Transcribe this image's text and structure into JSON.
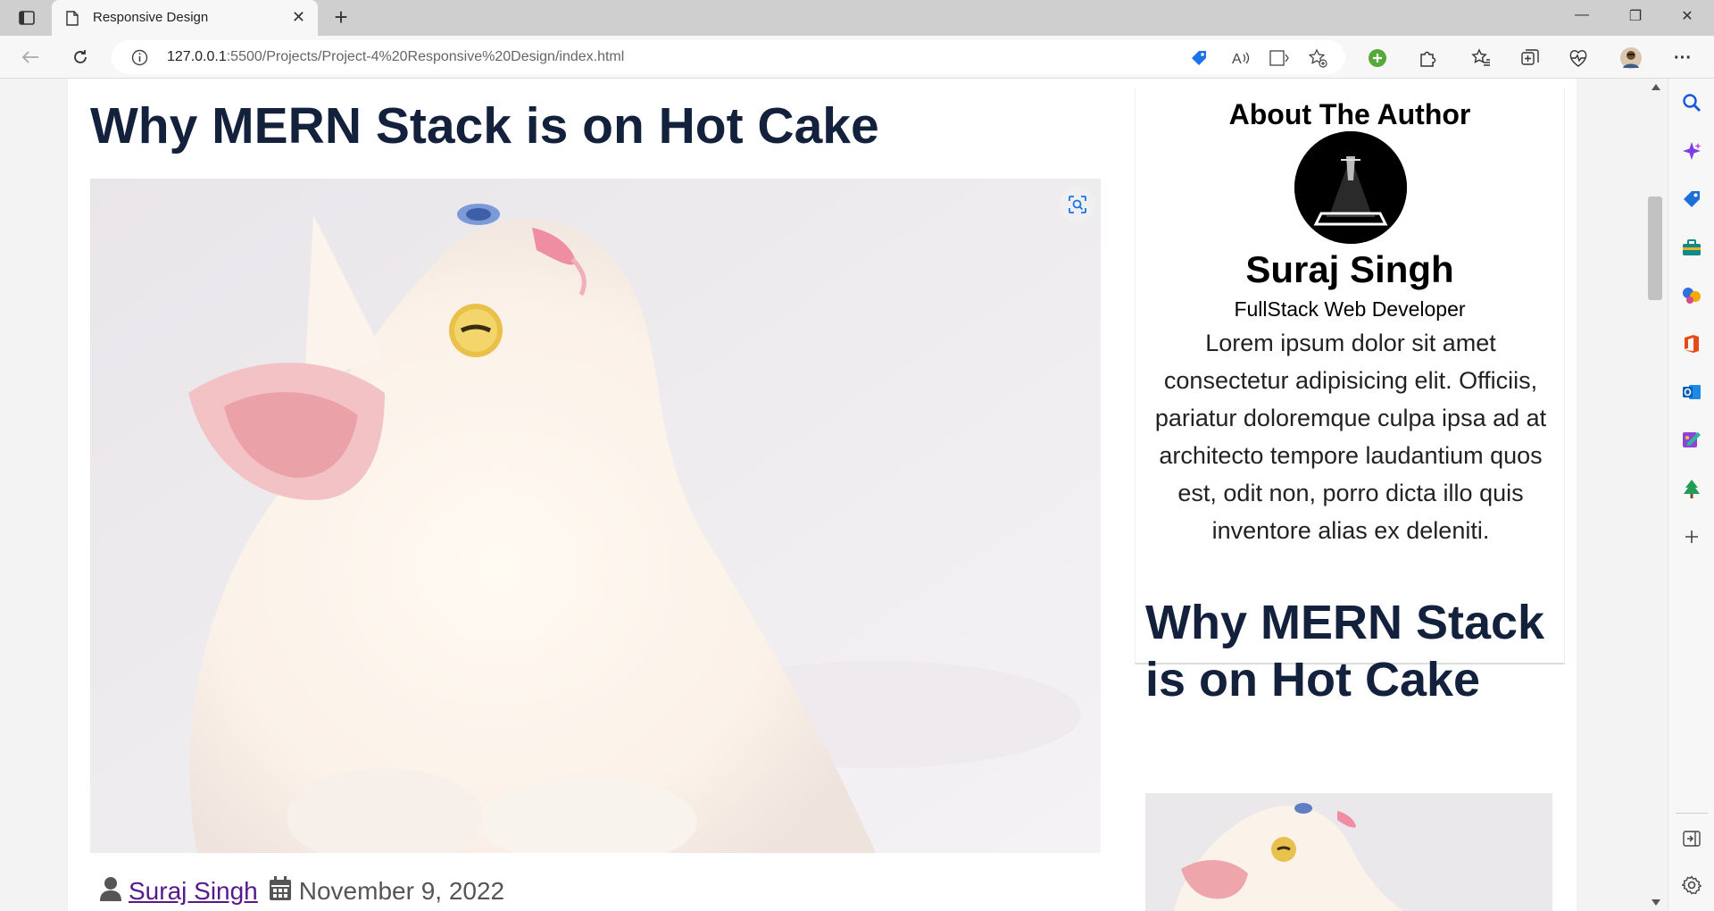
{
  "browser": {
    "tab_title": "Responsive Design",
    "url_host": "127.0.0.1",
    "url_rest": ":5500/Projects/Project-4%20Responsive%20Design/index.html",
    "window_controls": {
      "minimize": "—",
      "restore": "❐",
      "close": "✕"
    },
    "new_tab": "+",
    "tab_close": "✕",
    "more": "···"
  },
  "page": {
    "post_title": "Why MERN Stack is on Hot Cake",
    "post_author": "Suraj Singh",
    "post_date": "November 9, 2022",
    "about_heading": "About The Author",
    "author_name": "Suraj Singh",
    "author_role": "FullStack Web Developer",
    "author_bio": "Lorem ipsum dolor sit amet consectetur adipisicing elit. Officiis, pariatur doloremque culpa ipsa ad at architecto tempore laudantium quos est, odit non, porro dicta illo quis inventore alias ex deleniti.",
    "side_post_title": "Why MERN Stack is on Hot Cake"
  },
  "colors": {
    "title_navy": "#14213d",
    "link_purple": "#551a8b"
  }
}
